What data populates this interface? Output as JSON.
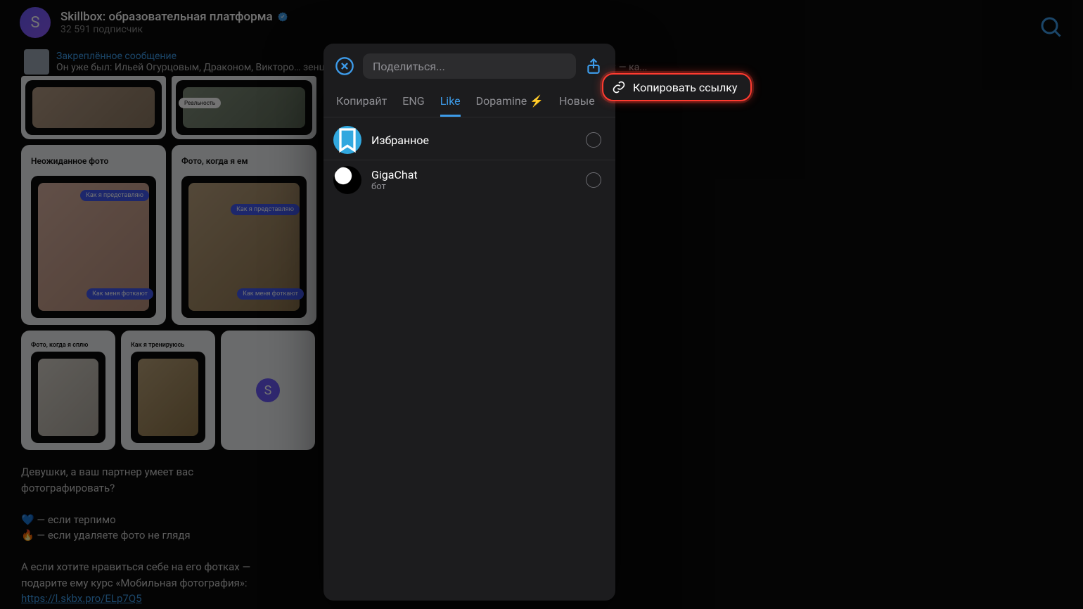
{
  "header": {
    "avatar_letter": "S",
    "title": "Skillbox: образовательная платформа",
    "subscribers": "32 591 подписчик"
  },
  "pinned": {
    "title": "Закреплённое сообщение",
    "preview": "Он уже был: Ильей Огурцовым, Драконом, Викторо…                                               зенцев?  Смотрите новый выпуск YouTube-шоу от Skillbox и узнайте: — ка..."
  },
  "thumbs": {
    "top0": "",
    "top1": "Реальность",
    "l0": "Неожиданное фото",
    "l1": "Фото, когда я ем",
    "s0": "Фото, когда я сплю",
    "s1": "Как я тренируюсь",
    "b0": "Как я представляю",
    "b1": "Как меня фоткают",
    "b2": "Как я представляю",
    "b3": "Как меня фоткают"
  },
  "message": {
    "line1": "Девушки, а ваш партнер умеет вас",
    "line2": "фотографировать?",
    "line3": "💙 — если терпимо",
    "line4": "🔥 — если удаляете фото не глядя",
    "line5": "А если хотите нравиться себе на его фотках —",
    "line6": "подарите ему курс «Мобильная фотография»:",
    "link": "https://l.skbx.pro/ELp7Q5"
  },
  "share": {
    "placeholder": "Поделиться...",
    "tabs": {
      "t0": "Копирайт",
      "t1": "ENG",
      "t2": "Like",
      "t3": "Dopamine ⚡",
      "t4": "Новые"
    },
    "rows": {
      "r0": {
        "title": "Избранное",
        "sub": ""
      },
      "r1": {
        "title": "GigaChat",
        "sub": "бот"
      }
    }
  },
  "ctx": {
    "copy_link": "Копировать ссылку"
  }
}
